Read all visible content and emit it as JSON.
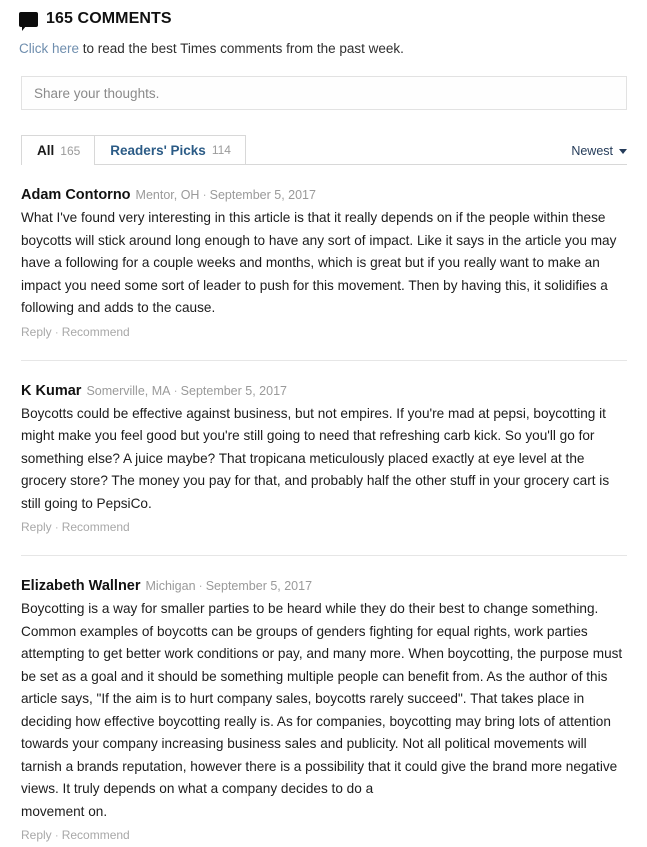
{
  "header": {
    "icon": "comment-bubble-icon",
    "title": "165 COMMENTS",
    "subhead_link": "Click here",
    "subhead_rest": " to read the best Times comments from the past week."
  },
  "share": {
    "placeholder": "Share your thoughts."
  },
  "tabs": [
    {
      "label": "All",
      "count": "165",
      "active": true
    },
    {
      "label": "Readers' Picks",
      "count": "114",
      "active": false
    }
  ],
  "sort": {
    "label": "Newest",
    "icon": "chevron-down-icon"
  },
  "actions": {
    "reply": "Reply",
    "separator": "·",
    "recommend": "Recommend"
  },
  "comments": [
    {
      "author": "Adam Contorno",
      "location": "Mentor, OH",
      "separator": "·",
      "date": "September 5, 2017",
      "body": "What I've found very interesting in this article is that it really depends on if the people within these boycotts will stick around long enough to have any sort of impact. Like it says in the article you may have a following for a couple weeks and months, which is great but if you really want to make an impact you need some sort of leader to push for this movement. Then by having this, it solidifies a following and adds to the cause.",
      "tail": ""
    },
    {
      "author": "K Kumar",
      "location": "Somerville, MA",
      "separator": "·",
      "date": "September 5, 2017",
      "body": "Boycotts could be effective against business, but not empires. If you're mad at pepsi, boycotting it might make you feel good but you're still going to need that refreshing carb kick. So you'll go for something else? A juice maybe? That tropicana meticulously placed exactly at eye level at the grocery store? The money you pay for that, and probably half the other stuff in your grocery cart is still going to PepsiCo.",
      "tail": ""
    },
    {
      "author": "Elizabeth Wallner",
      "location": "Michigan",
      "separator": "·",
      "date": "September 5, 2017",
      "body": "Boycotting is a way for smaller parties to be heard while they do their best to change something. Common examples of boycotts can be groups of genders fighting for equal rights, work parties attempting to get better work conditions or pay, and many more. When boycotting, the purpose must be set as a goal and it should be something multiple people can benefit from. As the author of this article says, \"If the aim is to hurt company sales, boycotts rarely succeed\". That takes place in deciding how effective boycotting really is. As for companies, boycotting may bring lots of attention towards your company increasing business sales and publicity. Not all political movements will tarnish a brands reputation, however there is a possibility that it could give the brand more negative views. It truly depends on what a company decides to do a",
      "tail": "movement on."
    }
  ]
}
